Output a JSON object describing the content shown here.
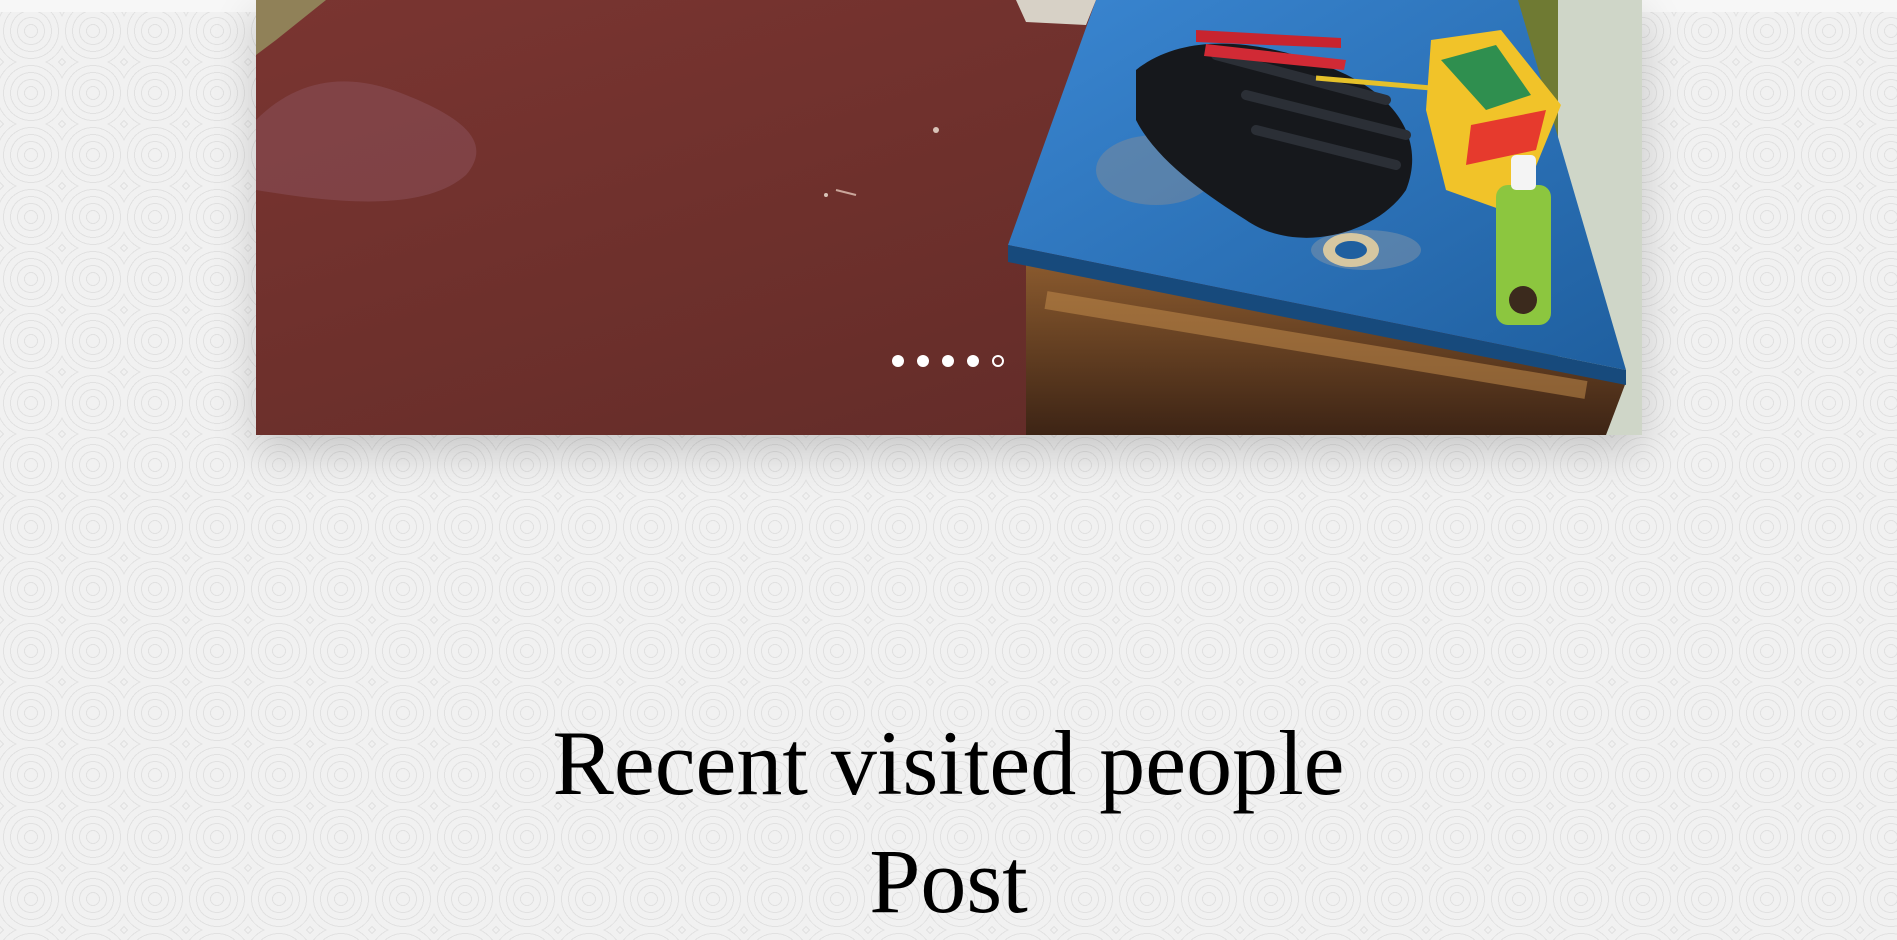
{
  "slider": {
    "image_alt": "",
    "dots_count": 5,
    "active_index": 4
  },
  "section": {
    "title_line1": "Recent visited people",
    "title_line2": "Post"
  },
  "colors": {
    "floor": "#6e2f2b",
    "table_top": "#2e7bc4",
    "table_wood": "#5a3520",
    "heading_text": "#000000",
    "background": "#f1f1f1"
  }
}
